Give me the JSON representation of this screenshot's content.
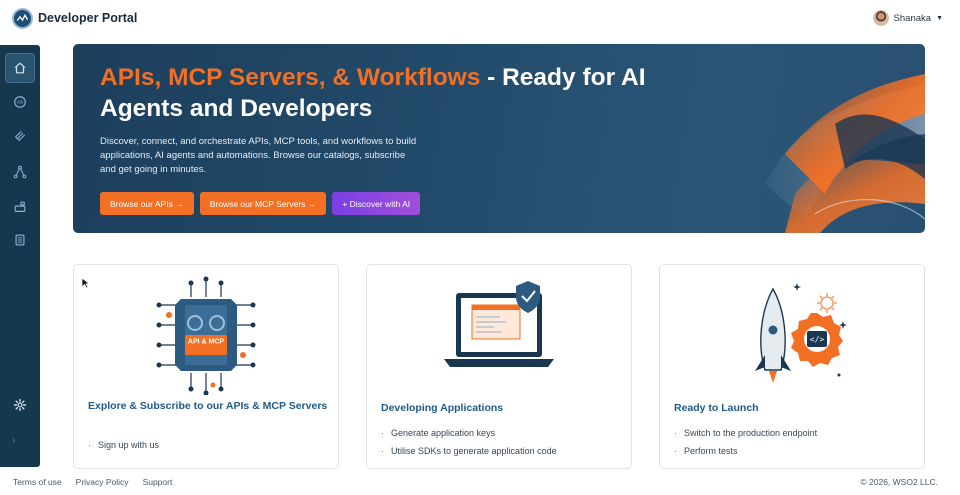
{
  "header": {
    "brand": "Developer Portal",
    "user_name": "Shanaka"
  },
  "sidebar": {
    "items": [
      {
        "icon": "home-icon",
        "active": true
      },
      {
        "icon": "api-icon",
        "active": false
      },
      {
        "icon": "mcp-icon",
        "active": false
      },
      {
        "icon": "workflow-icon",
        "active": false
      },
      {
        "icon": "applications-icon",
        "active": false
      },
      {
        "icon": "documents-icon",
        "active": false
      }
    ],
    "settings_icon": "gear-icon",
    "expand_icon": "chevron-right-icon"
  },
  "hero": {
    "title_accent": "APIs, MCP Servers, & Workflows",
    "title_rest": " - Ready for AI Agents and Developers",
    "description": "Discover, connect, and orchestrate APIs, MCP tools, and workflows to build applications, AI agents and automations. Browse our catalogs, subscribe and get going in minutes.",
    "buttons": {
      "apis": "Browse our APIs →",
      "mcp": "Browse our MCP Servers →",
      "ai": "+ Discover with AI"
    },
    "art_badge": "API & MCP"
  },
  "cards": [
    {
      "title": "Explore & Subscribe to our APIs & MCP Servers",
      "items": [
        "Sign up with us"
      ]
    },
    {
      "title": "Developing Applications",
      "items": [
        "Generate application keys",
        "Utilise SDKs to generate application code"
      ]
    },
    {
      "title": "Ready to Launch",
      "items": [
        "Switch to the production endpoint",
        "Perform tests"
      ]
    }
  ],
  "footer": {
    "links": [
      "Terms of use",
      "Privacy Policy",
      "Support"
    ],
    "copyright": "© 2026, WSO2 LLC."
  },
  "colors": {
    "accent_orange": "#f26f24",
    "sidebar_navy": "#15384f",
    "hero_blue": "#234b6b",
    "ai_purple": "#8a45e0",
    "card_title_blue": "#1f5a8a"
  }
}
